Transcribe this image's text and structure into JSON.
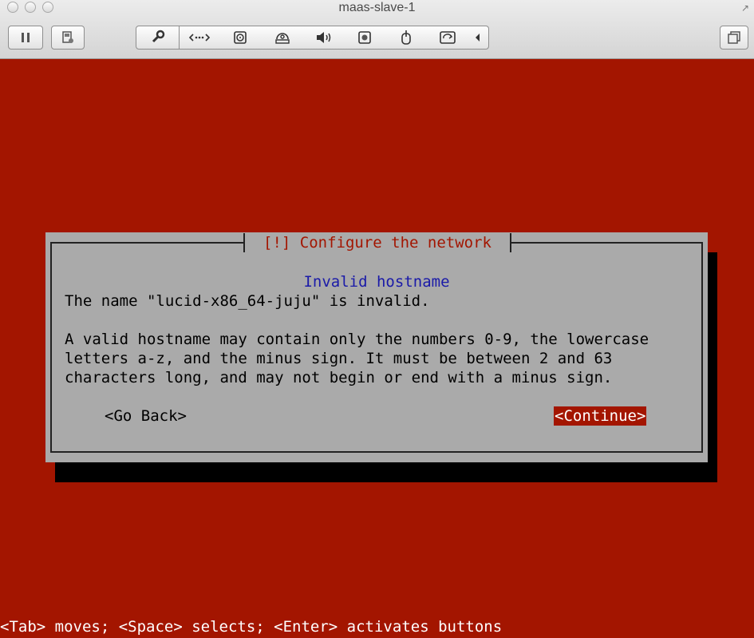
{
  "window": {
    "title": "maas-slave-1"
  },
  "toolbar": {
    "icons": [
      "pause-icon",
      "snapshot-icon",
      "settings-wrench-icon",
      "network-icon",
      "hard-disk-icon",
      "cd-rom-icon",
      "sound-icon",
      "camera-icon",
      "usb-icon",
      "shared-folders-icon",
      "arrow-left-icon",
      "fullscreen-icon"
    ]
  },
  "dialog": {
    "title": "[!] Configure the network",
    "subtitle": "Invalid hostname",
    "lines": [
      "The name \"lucid-x86_64-juju\" is invalid.",
      "A valid hostname may contain only the numbers 0-9, the lowercase",
      "letters a-z, and the minus sign. It must be between 2 and 63",
      "characters long, and may not begin or end with a minus sign."
    ],
    "go_back_label": "<Go Back>",
    "continue_label": "<Continue>"
  },
  "statusbar": {
    "text": "<Tab> moves; <Space> selects; <Enter> activates buttons"
  },
  "colors": {
    "background": "#a31500",
    "dialog": "#aaaaaa",
    "subtitle": "#1a1aa8",
    "selected_button": "#a31500"
  }
}
